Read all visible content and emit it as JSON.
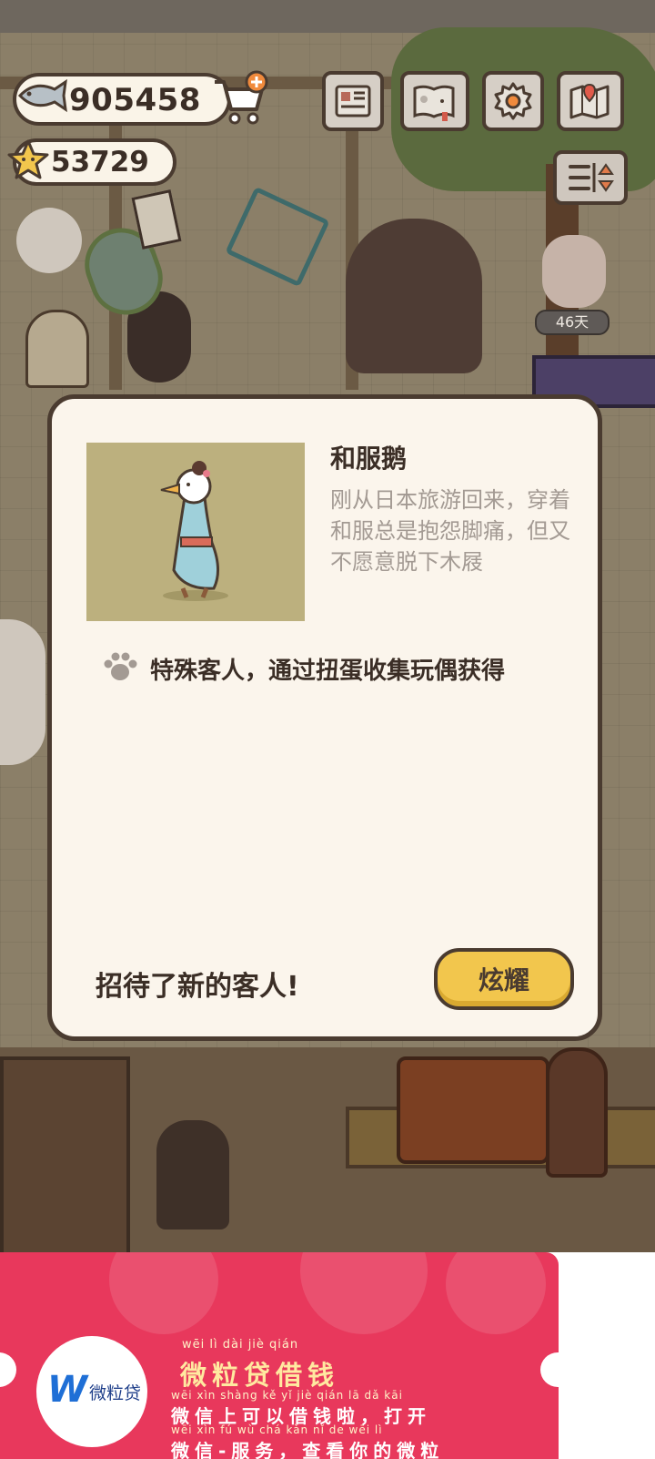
{
  "hud": {
    "fish_currency": "905458",
    "star_currency": "53729",
    "days_badge": "46天"
  },
  "icons": {
    "fish": "fish-icon",
    "star": "star-icon",
    "cart": "shop-cart-plus-icon",
    "newspaper": "newspaper-icon",
    "book": "paw-book-icon",
    "settings": "gear-icon",
    "map": "map-icon",
    "sort": "sort-toggle-icon"
  },
  "modal": {
    "guest_name": "和服鹅",
    "guest_desc": "刚从日本旅游回来，穿着和服总是抱怨脚痛，但又不愿意脱下木屐",
    "source": "特殊客人，通过扭蛋收集玩偶获得",
    "message": "招待了新的客人!",
    "show_button": "炫耀"
  },
  "ad": {
    "brand": "微粒贷",
    "title_pinyin": "wēi  lì   dài   jiè  qián",
    "title": "微粒贷借钱",
    "line1_pinyin": "wēi  xìn shàng  kě   yǐ   jiè  qián  lā        dǎ  kāi",
    "line1": "微信上可以借钱啦，打开",
    "line2_pinyin": "wēi  xìn   fú   wù         chá  kàn  nǐ   de  wēi  lì",
    "line2": "微信-服务，查看你的微粒"
  },
  "colors": {
    "modal_bg": "#fbf5ec",
    "outline": "#4a3b30",
    "button_yellow": "#f2c64d",
    "ad_red": "#e8385c",
    "desc_grey": "#a39a93"
  }
}
